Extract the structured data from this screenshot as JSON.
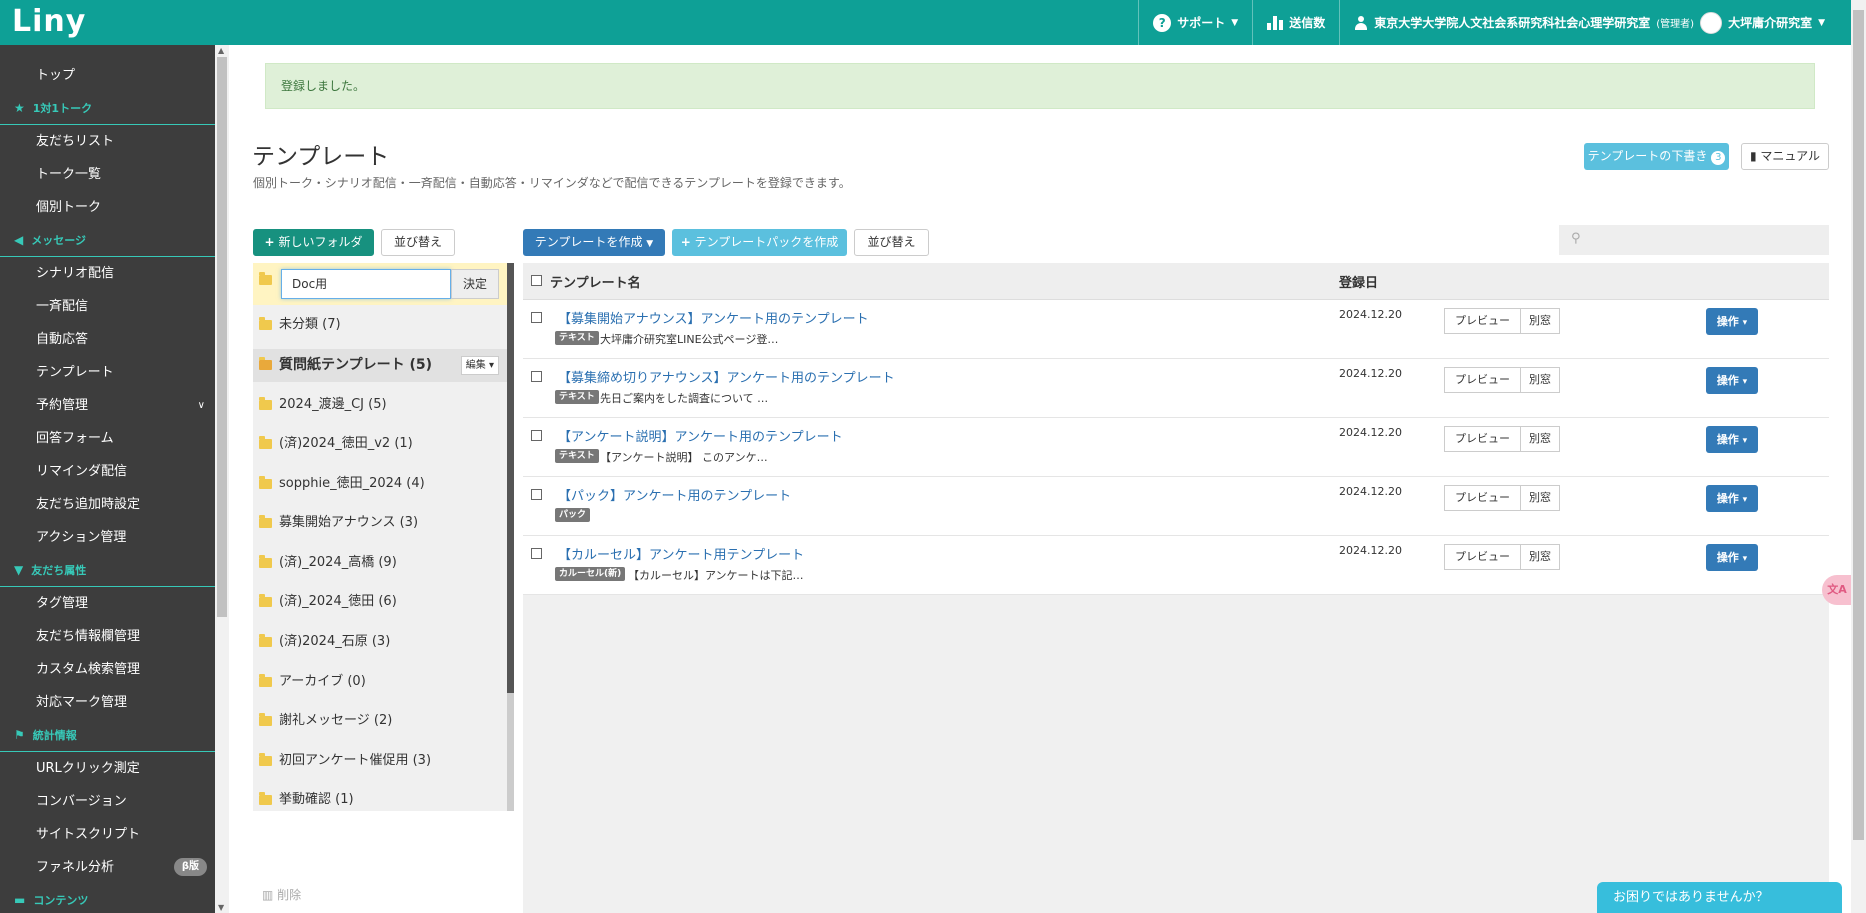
{
  "app": {
    "logo": "Liny"
  },
  "topnav": {
    "support": "サポート",
    "sent_count": "送信数",
    "account_org": "東京大学大学院人文社会系研究科社会心理学研究室",
    "account_role": "(管理者)",
    "account_lab": "大坪庸介研究室"
  },
  "sidebar": {
    "top": "トップ",
    "section_talk": "1対1トーク",
    "friends_list": "友だちリスト",
    "talk_list": "トーク一覧",
    "individual_talk": "個別トーク",
    "section_message": "メッセージ",
    "scenario": "シナリオ配信",
    "broadcast": "一斉配信",
    "auto_reply": "自動応答",
    "template": "テンプレート",
    "reservation": "予約管理",
    "answer_form": "回答フォーム",
    "reminder": "リマインダ配信",
    "friend_add_settings": "友だち追加時設定",
    "action_mgmt": "アクション管理",
    "section_attr": "友だち属性",
    "tag_mgmt": "タグ管理",
    "friend_info_mgmt": "友だち情報欄管理",
    "custom_search": "カスタム検索管理",
    "mark_mgmt": "対応マーク管理",
    "section_stats": "統計情報",
    "url_click": "URLクリック測定",
    "conversion": "コンバージョン",
    "site_script": "サイトスクリプト",
    "funnel": "ファネル分析",
    "beta": "β版",
    "section_contents": "コンテンツ"
  },
  "alert": "登録しました。",
  "page": {
    "title": "テンプレート",
    "subtitle": "個別トーク・シナリオ配信・一斉配信・自動応答・リマインダなどで配信できるテンプレートを登録できます。",
    "draft_btn": "テンプレートの下書き",
    "draft_count": "3",
    "manual_btn": "マニュアル"
  },
  "toolbar": {
    "new_folder": "新しいフォルダ",
    "sort_folders": "並び替え",
    "create_template": "テンプレートを作成",
    "create_pack": "テンプレートパックを作成",
    "sort_templates": "並び替え"
  },
  "folder_edit": {
    "value": "Doc用",
    "ok": "決定"
  },
  "folders": [
    "未分類 (7)",
    "質問紙テンプレート (5)",
    "2024_渡邊_CJ (5)",
    "(済)2024_徳田_v2 (1)",
    "sopphie_徳田_2024 (4)",
    "募集開始アナウンス (3)",
    "(済)_2024_高橋 (9)",
    "(済)_2024_徳田 (6)",
    "(済)2024_石原 (3)",
    "アーカイブ (0)",
    "謝礼メッセージ (2)",
    "初回アンケート催促用 (3)",
    "挙動確認 (1)"
  ],
  "folder_edit_btn": "編集",
  "delete_label": "削除",
  "table": {
    "col_name": "テンプレート名",
    "col_date": "登録日",
    "preview_btn": "プレビュー",
    "window_btn": "別窓",
    "op_btn": "操作",
    "rows": [
      {
        "title": "【募集開始アナウンス】アンケート用のテンプレート",
        "tag": "テキスト",
        "preview": "大坪庸介研究室LINE公式ページ登…",
        "date": "2024.12.20"
      },
      {
        "title": "【募集締め切りアナウンス】アンケート用のテンプレート",
        "tag": "テキスト",
        "preview": "先日ご案内をした調査について …",
        "date": "2024.12.20"
      },
      {
        "title": "【アンケート説明】アンケート用のテンプレート",
        "tag": "テキスト",
        "preview": "【アンケート説明】 このアンケ…",
        "date": "2024.12.20"
      },
      {
        "title": "【パック】アンケート用のテンプレート",
        "tag": "パック",
        "preview": "",
        "date": "2024.12.20"
      },
      {
        "title": "【カルーセル】アンケート用テンプレート",
        "tag": "カルーセル(新)",
        "preview": "【カルーセル】アンケートは下記…",
        "date": "2024.12.20"
      }
    ]
  },
  "help": "お困りではありませんか？",
  "translate": "文A",
  "colors": {
    "brand": "#0ea096",
    "accent": "#37c9b8",
    "primary": "#337ab7",
    "info": "#5bc0de"
  }
}
